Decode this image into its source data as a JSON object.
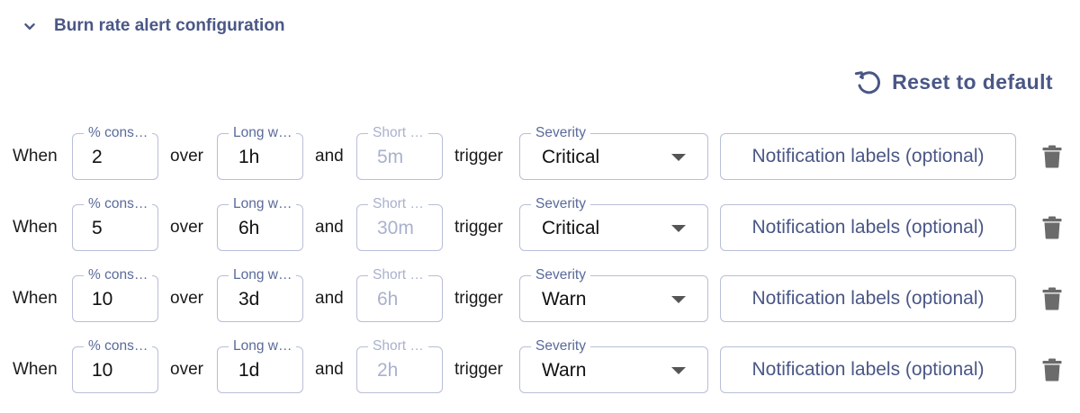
{
  "section": {
    "title": "Burn rate alert configuration",
    "icon": "chevron-down-icon"
  },
  "reset": {
    "label": "Reset to default",
    "icon": "reset-icon"
  },
  "words": {
    "when": "When",
    "over": "over",
    "and": "and",
    "trigger": "trigger"
  },
  "legends": {
    "percent": "% cons…",
    "long": "Long w…",
    "short": "Short …",
    "severity": "Severity"
  },
  "notification_label": "Notification labels (optional)",
  "rows": [
    {
      "percent": "2",
      "long": "1h",
      "short": "5m",
      "severity": "Critical"
    },
    {
      "percent": "5",
      "long": "6h",
      "short": "30m",
      "severity": "Critical"
    },
    {
      "percent": "10",
      "long": "3d",
      "short": "6h",
      "severity": "Warn"
    },
    {
      "percent": "10",
      "long": "1d",
      "short": "2h",
      "severity": "Warn"
    }
  ],
  "colors": {
    "accent": "#4a5786",
    "border": "#b8bfd6",
    "disabled": "#a9b1cc",
    "trash": "#6b6b6b"
  }
}
